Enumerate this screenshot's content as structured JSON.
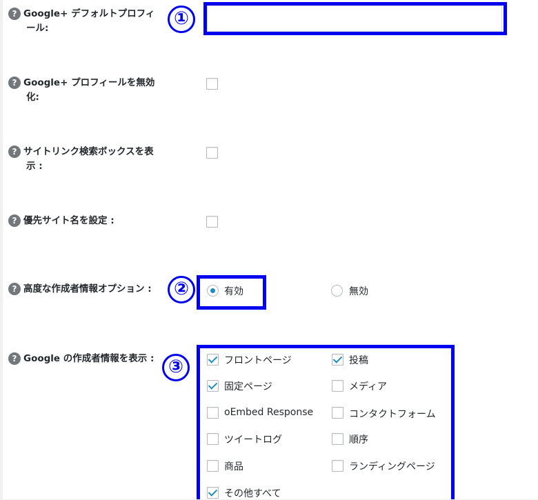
{
  "fields": {
    "default_profile": {
      "label_line1": "Google+ デフォルトプロフィ",
      "label_line2": "ール:",
      "value": ""
    },
    "disable_profile": {
      "label_line1": "Google+ プロフィールを無効",
      "label_line2": "化:"
    },
    "sitelink_search": {
      "label_line1": "サイトリンク検索ボックスを表",
      "label_line2": "示 :"
    },
    "preferred_site_name": {
      "label_line1": "優先サイト名を設定 :"
    },
    "advanced_author": {
      "label_line1": "高度な作成者情報オプション :",
      "options": [
        "有効",
        "無効"
      ],
      "selected": "有効"
    },
    "show_author": {
      "label_line1": "Google の作成者情報を表示 :",
      "items": [
        {
          "label": "フロントページ",
          "checked": true
        },
        {
          "label": "投稿",
          "checked": true
        },
        {
          "label": "固定ページ",
          "checked": true
        },
        {
          "label": "メディア",
          "checked": false
        },
        {
          "label": "oEmbed Response",
          "checked": false
        },
        {
          "label": "コンタクトフォーム",
          "checked": false
        },
        {
          "label": "ツイートログ",
          "checked": false
        },
        {
          "label": "順序",
          "checked": false
        },
        {
          "label": "商品",
          "checked": false
        },
        {
          "label": "ランディングページ",
          "checked": false
        },
        {
          "label": "その他すべて",
          "checked": true
        }
      ]
    }
  },
  "help_icon_glyph": "?",
  "markers": [
    "①",
    "②",
    "③"
  ],
  "colors": {
    "annotation": "#0000ee",
    "check": "#1e8cbe"
  }
}
